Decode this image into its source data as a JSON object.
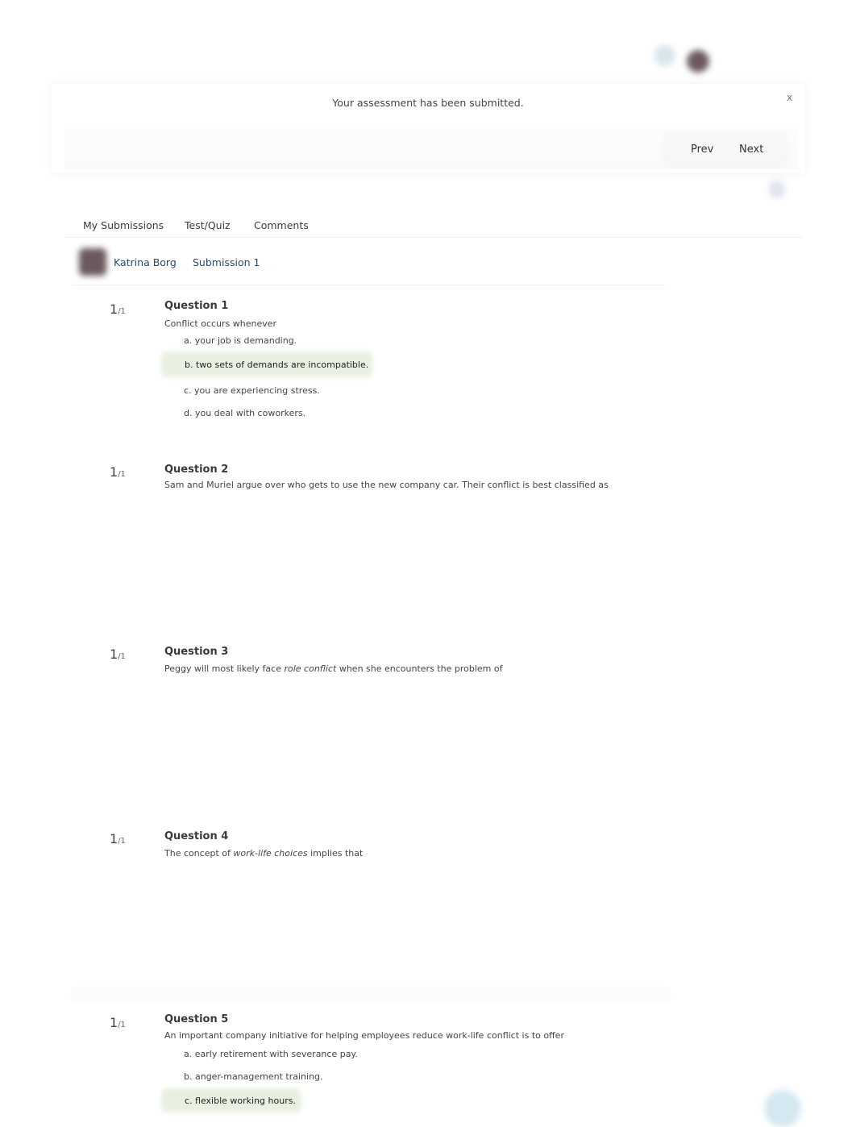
{
  "header": {
    "avatars": [
      "help-avatar",
      "user-avatar"
    ]
  },
  "banner": {
    "message": "Your assessment has been submitted.",
    "close_label": "x"
  },
  "nav": {
    "prev_label": "Prev",
    "next_label": "Next"
  },
  "tabs": [
    {
      "label": "My Submissions"
    },
    {
      "label": "Test/Quiz"
    },
    {
      "label": "Comments"
    }
  ],
  "submission": {
    "user_name": "Katrina Borg",
    "submission_label": "Submission 1"
  },
  "questions": [
    {
      "score": "1",
      "out_of": "/1",
      "title": "Question 1",
      "prompt": "Conflict occurs whenever",
      "options": [
        {
          "text": "a. your job is demanding.",
          "selected": false
        },
        {
          "text": "b. two sets of demands are incompatible.",
          "selected": true
        },
        {
          "text": "c. you are experiencing stress.",
          "selected": false
        },
        {
          "text": "d. you deal with coworkers.",
          "selected": false
        }
      ]
    },
    {
      "score": "1",
      "out_of": "/1",
      "title": "Question 2",
      "prompt": "Sam and Muriel argue over who gets to use the new company car. Their conflict is best classified as",
      "options": []
    },
    {
      "score": "1",
      "out_of": "/1",
      "title": "Question 3",
      "prompt_before": "Peggy will most likely face ",
      "prompt_em": "role conflict",
      "prompt_after": " when she encounters the problem of",
      "options": []
    },
    {
      "score": "1",
      "out_of": "/1",
      "title": "Question 4",
      "prompt_before": "The concept of ",
      "prompt_em": "work-life choices",
      "prompt_after": " implies that",
      "options": []
    },
    {
      "score": "1",
      "out_of": "/1",
      "title": "Question 5",
      "prompt": "An important company initiative for helping employees reduce work-life conflict is to offer",
      "options": [
        {
          "text": "a. early retirement with severance pay.",
          "selected": false
        },
        {
          "text": "b. anger-management training.",
          "selected": false
        },
        {
          "text": "c. flexible working hours.",
          "selected": true
        }
      ]
    }
  ]
}
